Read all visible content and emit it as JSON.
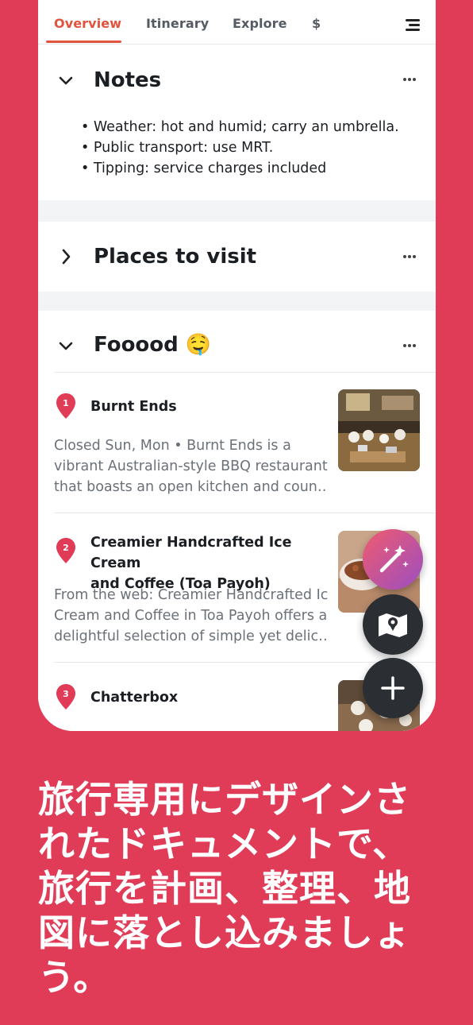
{
  "tabs": [
    {
      "label": "Overview",
      "active": true
    },
    {
      "label": "Itinerary",
      "active": false
    },
    {
      "label": "Explore",
      "active": false
    },
    {
      "label": "$",
      "active": false
    }
  ],
  "notes": {
    "title": "Notes",
    "expanded": true,
    "lines": [
      "• Weather: hot and humid; carry an umbrella.",
      "• Public transport: use MRT.",
      "• Tipping: service charges included"
    ]
  },
  "places_section": {
    "title": "Places to visit",
    "expanded": false
  },
  "food_section": {
    "title": "Fooood 🤤",
    "expanded": true,
    "places": [
      {
        "number": "1",
        "name": "Burnt Ends",
        "desc_lines": [
          "Closed Sun, Mon • Burnt Ends is a",
          "vibrant Australian-style BBQ restaurant",
          "that boasts an open kitchen and coun…"
        ]
      },
      {
        "number": "2",
        "name_lines": [
          "Creamier Handcrafted Ice Cream",
          "and Coffee (Toa Payoh)"
        ],
        "desc_lines": [
          "From the web: Creamier Handcrafted Ice",
          "Cream and Coffee in Toa Payoh offers a",
          "delightful selection of simple yet delic…"
        ]
      },
      {
        "number": "3",
        "name": "Chatterbox"
      }
    ]
  },
  "fabs": {
    "magic_icon": "magic-wand-icon",
    "map_icon": "map-icon",
    "add_icon": "plus-icon"
  },
  "promo_lines": [
    "旅行専用にデザインさ",
    "れたドキュメントで、",
    "旅行を計画、整理、地",
    "図に落とし込みましょ",
    "う。"
  ],
  "colors": {
    "background": "#e03c58",
    "accent": "#e2533d",
    "pin": "#e03c58"
  }
}
